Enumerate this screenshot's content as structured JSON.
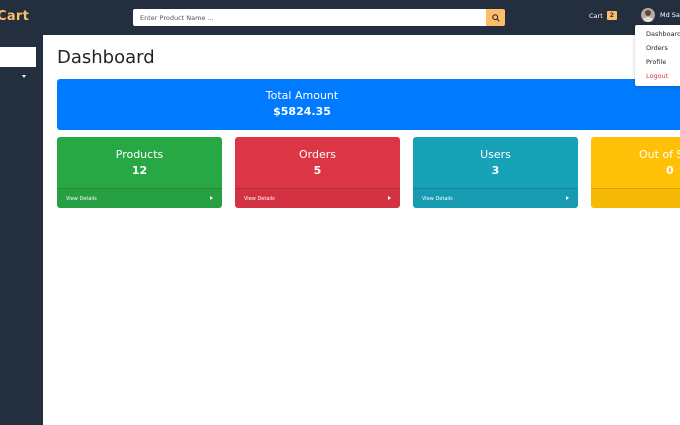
{
  "header": {
    "brand": "Cart",
    "search_placeholder": "Enter Product Name ...",
    "cart_label": "Cart",
    "cart_count": "2",
    "user_name": "Md Sa"
  },
  "user_menu": {
    "items": [
      "Dashboard",
      "Orders",
      "Profile",
      "Logout"
    ]
  },
  "main": {
    "title": "Dashboard",
    "total": {
      "label": "Total Amount",
      "value": "$5824.35"
    },
    "cards": [
      {
        "label": "Products",
        "value": "12",
        "link": "View Details"
      },
      {
        "label": "Orders",
        "value": "5",
        "link": "View Details"
      },
      {
        "label": "Users",
        "value": "3",
        "link": "View Details"
      },
      {
        "label": "Out of S",
        "value": "0"
      }
    ]
  },
  "colors": {
    "navbar": "#232f3e",
    "accent": "#febd69",
    "primary": "#007bff",
    "success": "#28a745",
    "danger": "#dc3545",
    "info": "#17a2b8",
    "warning": "#ffc107"
  }
}
